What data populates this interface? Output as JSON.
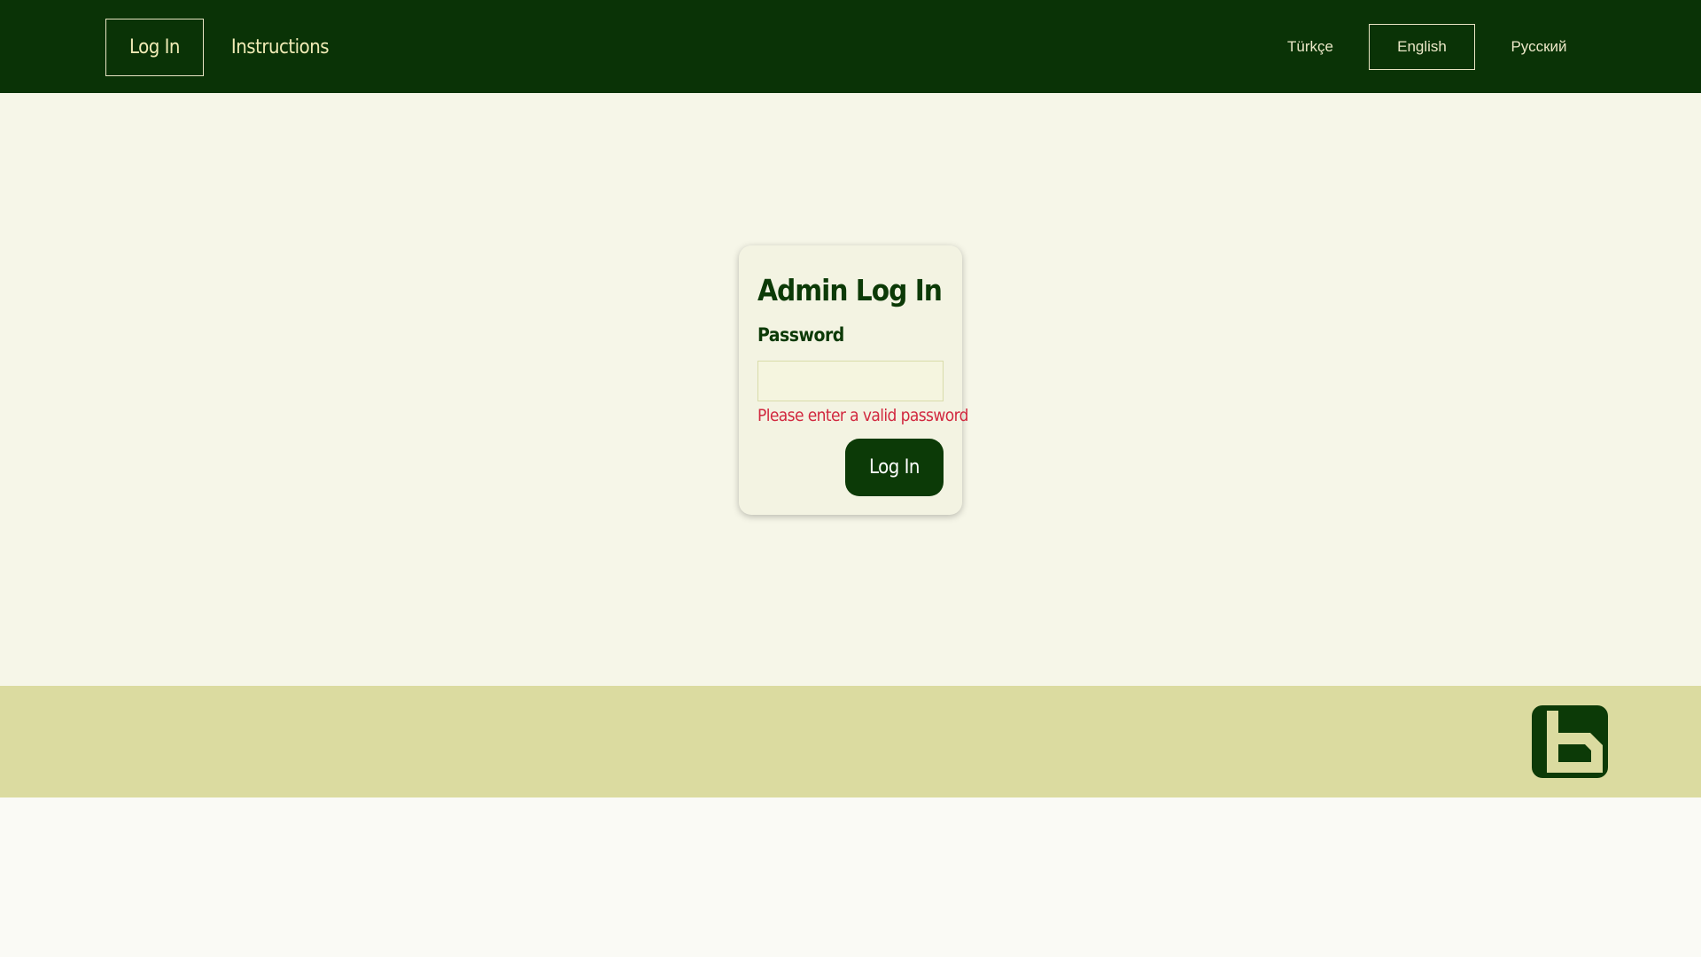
{
  "nav": {
    "login_label": "Log In",
    "instructions_label": "Instructions"
  },
  "languages": {
    "turkish": "Türkçe",
    "english": "English",
    "russian": "Русский",
    "selected": "English"
  },
  "login_card": {
    "title": "Admin Log In",
    "password_label": "Password",
    "password_value": "",
    "error_message": "Please enter a valid password",
    "submit_label": "Log In"
  },
  "footer": {
    "logo_icon": "b-logo-icon"
  },
  "colors": {
    "header_bg": "#0a3306",
    "accent_green": "#0c3a07",
    "page_bg": "#f6f6e8",
    "footer_bg": "#dbdba0",
    "error": "#d1283f"
  }
}
